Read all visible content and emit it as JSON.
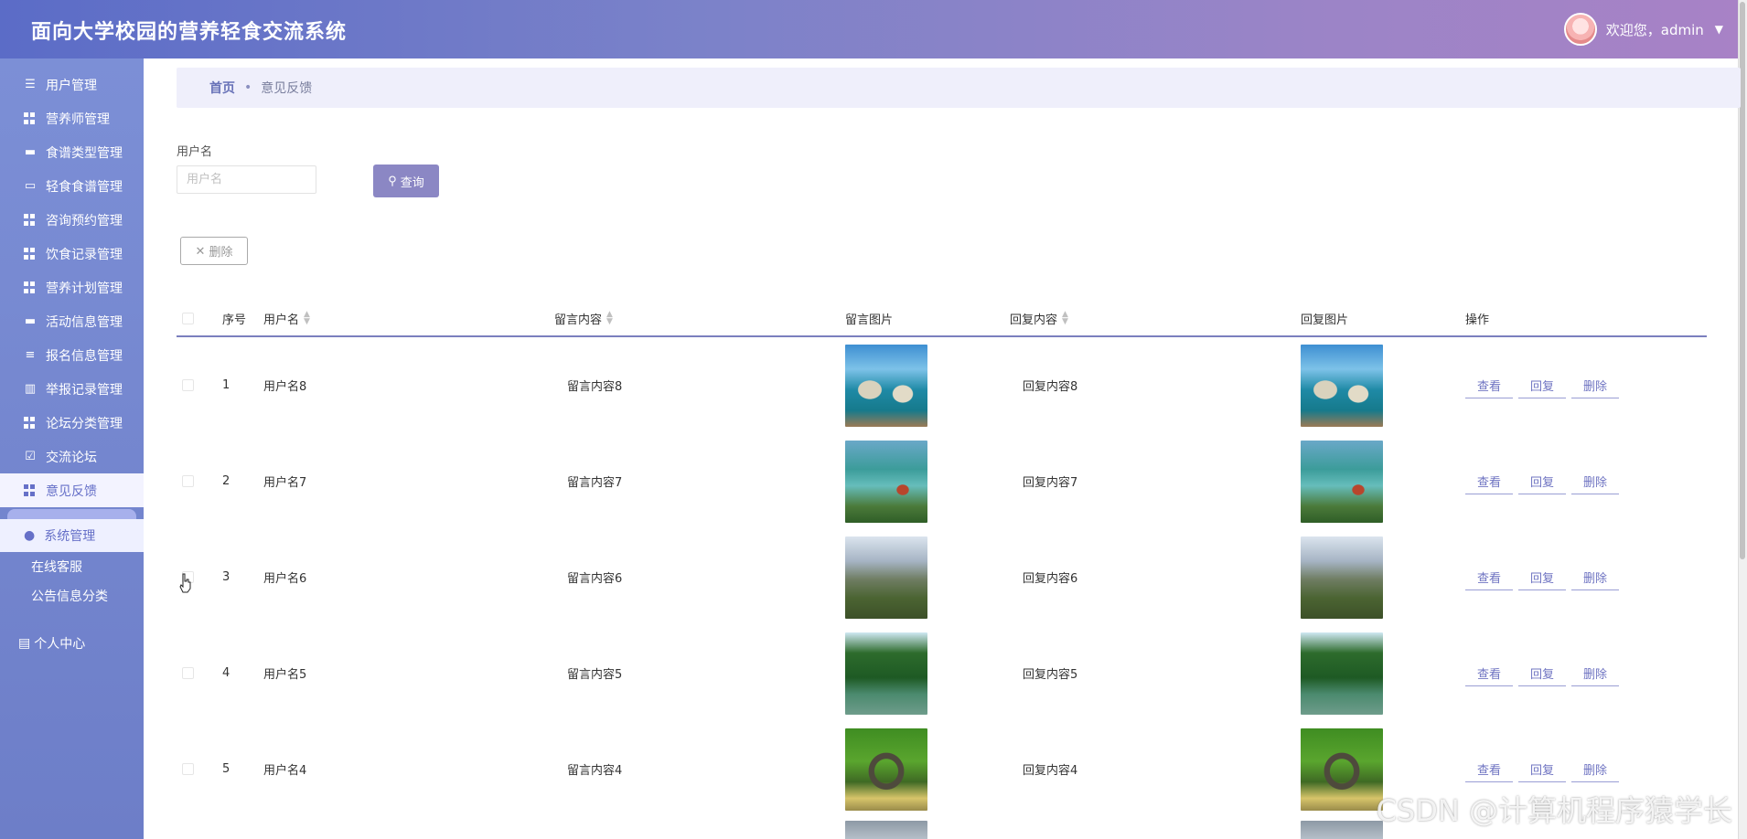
{
  "header": {
    "title": "面向大学校园的营养轻食交流系统",
    "welcome": "欢迎您，admin"
  },
  "sidebar": {
    "items": [
      {
        "label": "用户管理",
        "icon": "list-icon"
      },
      {
        "label": "营养师管理",
        "icon": "grid-icon"
      },
      {
        "label": "食谱类型管理",
        "icon": "printer-icon"
      },
      {
        "label": "轻食食谱管理",
        "icon": "monitor-icon"
      },
      {
        "label": "咨询预约管理",
        "icon": "grid-icon"
      },
      {
        "label": "饮食记录管理",
        "icon": "grid-icon"
      },
      {
        "label": "营养计划管理",
        "icon": "grid-icon"
      },
      {
        "label": "活动信息管理",
        "icon": "printer-icon"
      },
      {
        "label": "报名信息管理",
        "icon": "sliders-icon"
      },
      {
        "label": "举报记录管理",
        "icon": "chart-icon"
      },
      {
        "label": "论坛分类管理",
        "icon": "grid-icon"
      },
      {
        "label": "交流论坛",
        "icon": "check-box-icon"
      },
      {
        "label": "意见反馈",
        "icon": "grid-icon",
        "active": true
      }
    ],
    "system": "系统管理",
    "sub_links": [
      "在线客服",
      "公告信息分类"
    ],
    "personal": "个人中心"
  },
  "breadcrumb": {
    "home": "首页",
    "current": "意见反馈"
  },
  "search": {
    "label": "用户名",
    "placeholder": "用户名",
    "button": "查询"
  },
  "actions": {
    "delete": "删除"
  },
  "table": {
    "headers": {
      "no": "序号",
      "username": "用户名",
      "message": "留言内容",
      "message_image": "留言图片",
      "reply": "回复内容",
      "reply_image": "回复图片",
      "ops": "操作"
    },
    "rows": [
      {
        "no": "1",
        "username": "用户名8",
        "message": "留言内容8",
        "reply": "回复内容8",
        "image": "img-sea"
      },
      {
        "no": "2",
        "username": "用户名7",
        "message": "留言内容7",
        "reply": "回复内容7",
        "image": "img-lake"
      },
      {
        "no": "3",
        "username": "用户名6",
        "message": "留言内容6",
        "reply": "回复内容6",
        "image": "img-mountain"
      },
      {
        "no": "4",
        "username": "用户名5",
        "message": "留言内容5",
        "reply": "回复内容5",
        "image": "img-forest"
      },
      {
        "no": "5",
        "username": "用户名4",
        "message": "留言内容4",
        "reply": "回复内容4",
        "image": "img-bridge"
      }
    ],
    "ops": {
      "view": "查看",
      "reply": "回复",
      "delete": "删除"
    }
  },
  "watermark": "CSDN @计算机程序猿学长",
  "colors": {
    "accent": "#8b87c4",
    "sidebar": "#6d7ec8",
    "link": "#6f74c2"
  }
}
